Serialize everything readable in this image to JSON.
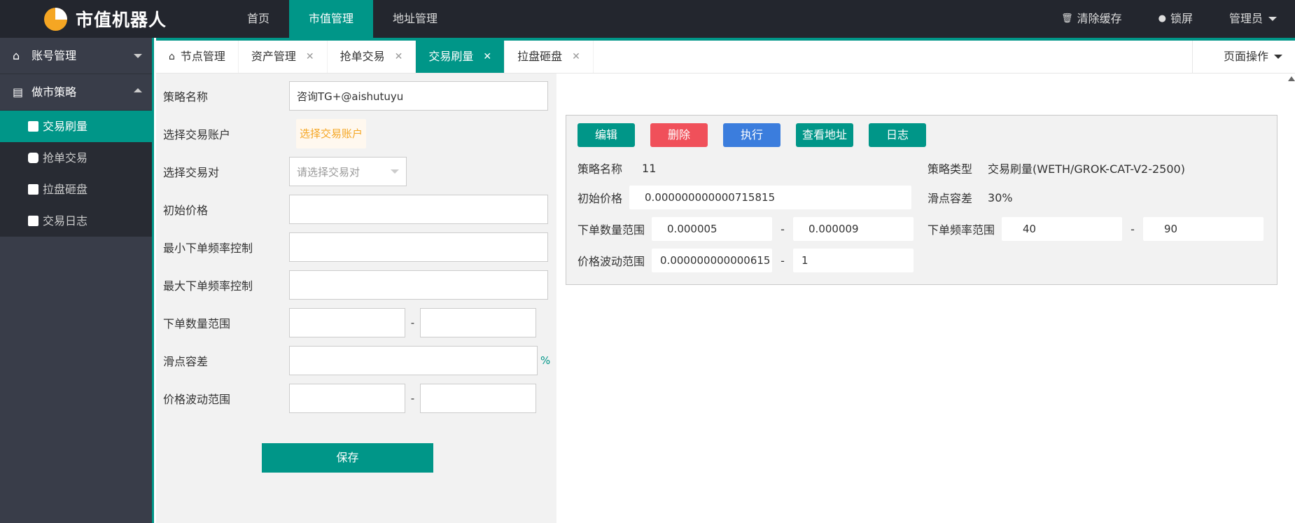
{
  "header": {
    "logo_text": "市值机器人",
    "nav": [
      {
        "label": "首页"
      },
      {
        "label": "市值管理"
      },
      {
        "label": "地址管理"
      }
    ],
    "clear_cache": "清除缓存",
    "lock_screen": "锁屏",
    "user": "管理员"
  },
  "sidebar": {
    "group_account": "账号管理",
    "group_market": "做市策略",
    "items": [
      {
        "label": "交易刷量"
      },
      {
        "label": "抢单交易"
      },
      {
        "label": "拉盘砸盘"
      },
      {
        "label": "交易日志"
      }
    ]
  },
  "tabs": [
    {
      "label": "节点管理"
    },
    {
      "label": "资产管理"
    },
    {
      "label": "抢单交易"
    },
    {
      "label": "交易刷量"
    },
    {
      "label": "拉盘砸盘"
    }
  ],
  "page_ops": "页面操作",
  "form": {
    "strategy_name_label": "策略名称",
    "strategy_name_value": "咨询TG+@aishutuyu",
    "account_label": "选择交易账户",
    "account_button": "选择交易账户",
    "pair_label": "选择交易对",
    "pair_placeholder": "请选择交易对",
    "init_price_label": "初始价格",
    "min_freq_label": "最小下单频率控制",
    "max_freq_label": "最大下单频率控制",
    "qty_range_label": "下单数量范围",
    "slippage_label": "滑点容差",
    "price_range_label": "价格波动范围",
    "dash": "-",
    "percent": "%",
    "save": "保存"
  },
  "card": {
    "buttons": {
      "edit": "编辑",
      "delete": "删除",
      "execute": "执行",
      "view_address": "查看地址",
      "log": "日志"
    },
    "strategy_name_label": "策略名称",
    "strategy_name_value": "11",
    "strategy_type_label": "策略类型",
    "strategy_type_value": "交易刷量(WETH/GROK-CAT-V2-2500)",
    "init_price_label": "初始价格",
    "init_price_value": "0.000000000000715815",
    "slippage_label": "滑点容差",
    "slippage_value": "30%",
    "qty_range_label": "下单数量范围",
    "qty_min": "0.000005",
    "qty_max": "0.000009",
    "freq_range_label": "下单频率范围",
    "freq_min": "40",
    "freq_max": "90",
    "price_range_label": "价格波动范围",
    "price_min": "0.000000000000615",
    "price_max": "1",
    "dash": "-"
  },
  "colors": {
    "accent": "#009688",
    "header_bg": "#23262e",
    "sidebar_bg": "#393d49",
    "danger": "#f0505a",
    "primary": "#3b7ddd",
    "warning": "#f5a623"
  }
}
